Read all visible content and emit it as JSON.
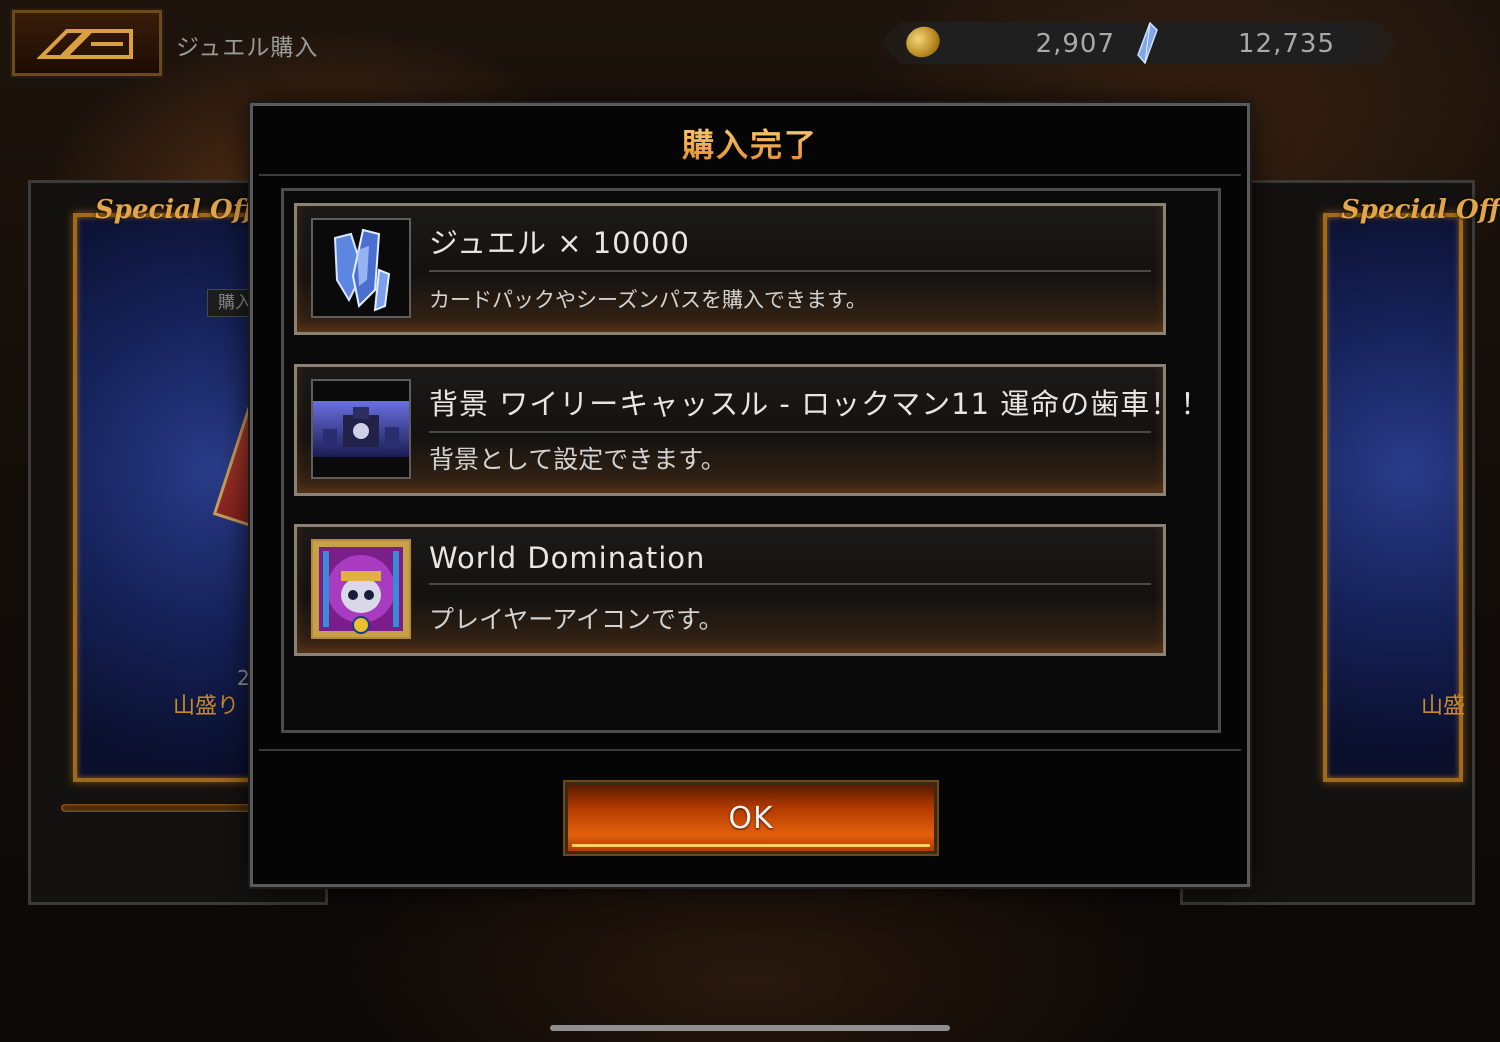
{
  "header": {
    "back_icon": "game-logo-back-icon",
    "title": "ジュエル購入",
    "coin_icon": "gold-coin-icon",
    "coins": "2,907",
    "jewel_icon": "blue-jewel-icon",
    "jewels": "12,735"
  },
  "background": {
    "left_panel": {
      "label": "Special Offer",
      "tag": "購入",
      "count_fragment": "2",
      "subtitle": "山盛り"
    },
    "right_panel": {
      "label": "Special Off",
      "subtitle": "山盛"
    }
  },
  "dialog": {
    "title": "購入完了",
    "items": [
      {
        "icon": "jewel-crystal-icon",
        "name": "ジュエル × 10000",
        "description": "カードパックやシーズンパスを購入できます。"
      },
      {
        "icon": "wily-castle-background-thumbnail",
        "name": "背景 ワイリーキャッスル - ロックマン11 運命の歯車！！",
        "description": "背景として設定できます。"
      },
      {
        "icon": "world-domination-player-icon",
        "name": "World Domination",
        "description": "プレイヤーアイコンです。"
      }
    ],
    "ok_label": "OK"
  },
  "colors": {
    "title_gold": "#f2b24a",
    "ok_orange": "#e2600c",
    "offer_gold": "#e2a648"
  }
}
